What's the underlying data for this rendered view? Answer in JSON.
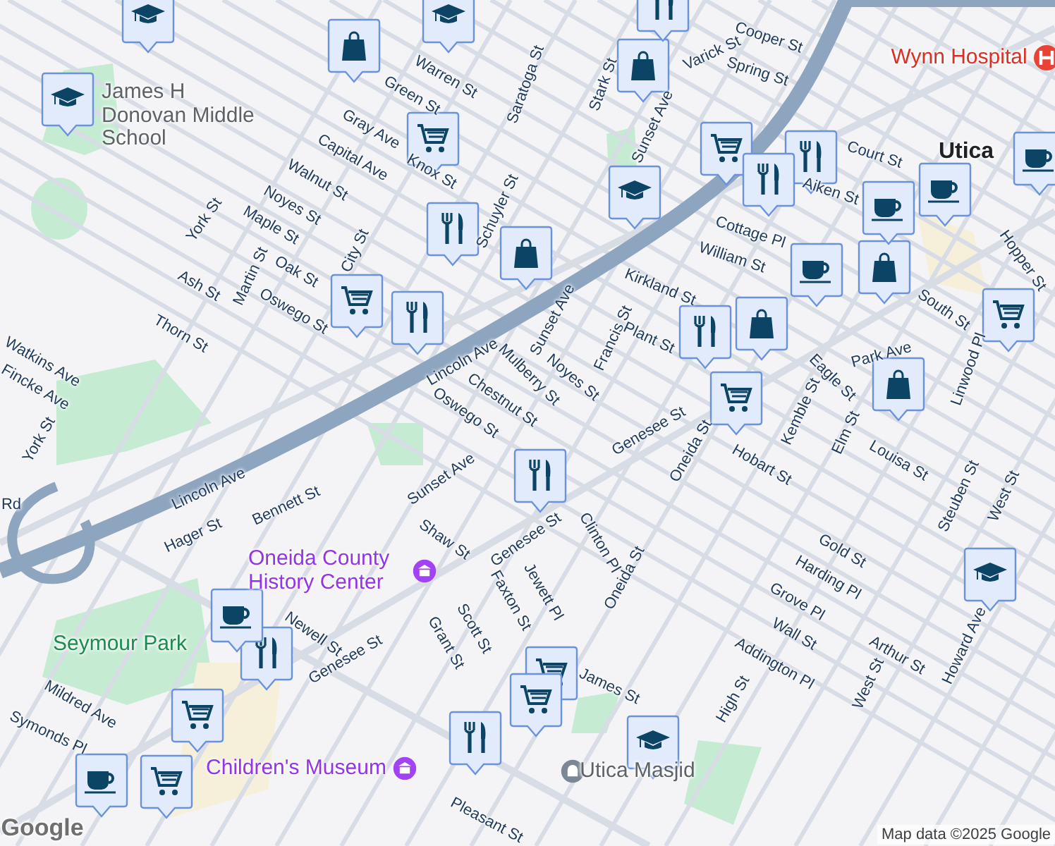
{
  "labels": [
    {
      "text": "Warren St",
      "kind": "street"
    },
    {
      "text": "Green St",
      "kind": "street"
    },
    {
      "text": "Saratoga St",
      "kind": "street"
    },
    {
      "text": "Gray Ave",
      "kind": "street"
    },
    {
      "text": "Capital Ave",
      "kind": "street"
    },
    {
      "text": "Walnut St",
      "kind": "street"
    },
    {
      "text": "Noyes St",
      "kind": "street"
    },
    {
      "text": "Maple St",
      "kind": "street"
    },
    {
      "text": "York St",
      "kind": "street"
    },
    {
      "text": "City St",
      "kind": "street"
    },
    {
      "text": "Martin St",
      "kind": "street"
    },
    {
      "text": "Oak St",
      "kind": "street"
    },
    {
      "text": "Ash St",
      "kind": "street"
    },
    {
      "text": "Oswego St",
      "kind": "street"
    },
    {
      "text": "Thorn St",
      "kind": "street"
    },
    {
      "text": "Knox St",
      "kind": "street"
    },
    {
      "text": "Schuyler St",
      "kind": "street"
    },
    {
      "text": "Watkins Ave",
      "kind": "street"
    },
    {
      "text": "Fincke Ave",
      "kind": "street"
    },
    {
      "text": "York St",
      "kind": "street"
    },
    {
      "text": "Lincoln Ave",
      "kind": "street"
    },
    {
      "text": "Mulberry St",
      "kind": "street"
    },
    {
      "text": "Chestnut St",
      "kind": "street"
    },
    {
      "text": "Oswego St",
      "kind": "street"
    },
    {
      "text": "Sunset Ave",
      "kind": "street"
    },
    {
      "text": "Noyes St",
      "kind": "street"
    },
    {
      "text": "Francis St",
      "kind": "street"
    },
    {
      "text": "Kirkland St",
      "kind": "street"
    },
    {
      "text": "Plant St",
      "kind": "street"
    },
    {
      "text": "Stark St",
      "kind": "street"
    },
    {
      "text": "Sunset Ave",
      "kind": "street"
    },
    {
      "text": "Varick St",
      "kind": "street"
    },
    {
      "text": "Cooper St",
      "kind": "street"
    },
    {
      "text": "Spring St",
      "kind": "street"
    },
    {
      "text": "Court St",
      "kind": "street"
    },
    {
      "text": "Aiken St",
      "kind": "street"
    },
    {
      "text": "Cottage Pl",
      "kind": "street"
    },
    {
      "text": "William St",
      "kind": "street"
    },
    {
      "text": "South St",
      "kind": "street"
    },
    {
      "text": "Hopper St",
      "kind": "street"
    },
    {
      "text": "Park Ave",
      "kind": "street"
    },
    {
      "text": "Eagle St",
      "kind": "street"
    },
    {
      "text": "Kemble St",
      "kind": "street"
    },
    {
      "text": "Elm St",
      "kind": "street"
    },
    {
      "text": "Linwood Pl",
      "kind": "street"
    },
    {
      "text": "Louisa St",
      "kind": "street"
    },
    {
      "text": "Hobart St",
      "kind": "street"
    },
    {
      "text": "Oneida St",
      "kind": "street"
    },
    {
      "text": "Genesee St",
      "kind": "street"
    },
    {
      "text": "Steuben St",
      "kind": "street"
    },
    {
      "text": "West St",
      "kind": "street"
    },
    {
      "text": "Gold St",
      "kind": "street"
    },
    {
      "text": "Harding Pl",
      "kind": "street"
    },
    {
      "text": "Grove Pl",
      "kind": "street"
    },
    {
      "text": "Wall St",
      "kind": "street"
    },
    {
      "text": "Addington Pl",
      "kind": "street"
    },
    {
      "text": "High St",
      "kind": "street"
    },
    {
      "text": "West St",
      "kind": "street"
    },
    {
      "text": "Arthur St",
      "kind": "street"
    },
    {
      "text": "Howard Ave",
      "kind": "street"
    },
    {
      "text": "Clinton Pl",
      "kind": "street"
    },
    {
      "text": "Oneida St",
      "kind": "street"
    },
    {
      "text": "Jewett Pl",
      "kind": "street"
    },
    {
      "text": "James St",
      "kind": "street"
    },
    {
      "text": "Lincoln Ave",
      "kind": "street"
    },
    {
      "text": "Bennett St",
      "kind": "street"
    },
    {
      "text": "Hager St",
      "kind": "street"
    },
    {
      "text": "Sunset Ave",
      "kind": "street"
    },
    {
      "text": "Shaw St",
      "kind": "street"
    },
    {
      "text": "Genesee St",
      "kind": "street"
    },
    {
      "text": "Genesee St",
      "kind": "street"
    },
    {
      "text": "Newell St",
      "kind": "street"
    },
    {
      "text": "Scott St",
      "kind": "street"
    },
    {
      "text": "Faxton St",
      "kind": "street"
    },
    {
      "text": "Grant St",
      "kind": "street"
    },
    {
      "text": "Mildred Ave",
      "kind": "street"
    },
    {
      "text": "Symonds Pl",
      "kind": "street"
    },
    {
      "text": "Pleasant St",
      "kind": "street"
    },
    {
      "text": "Rd",
      "kind": "street"
    },
    {
      "text": "James H Donovan Middle School",
      "kind": "place"
    },
    {
      "text": "Wynn Hospital",
      "kind": "hospital"
    },
    {
      "text": "Utica",
      "kind": "city"
    },
    {
      "text": "Oneida County History Center",
      "kind": "museum"
    },
    {
      "text": "Seymour Park",
      "kind": "park"
    },
    {
      "text": "Children's Museum",
      "kind": "museum"
    },
    {
      "text": "Utica Masjid",
      "kind": "mosque"
    },
    {
      "text": "Google",
      "kind": "logo"
    },
    {
      "text": "Map data ©2025 Google",
      "kind": "credit"
    }
  ],
  "markers": [
    {
      "kind": "school"
    },
    {
      "kind": "school"
    },
    {
      "kind": "school"
    },
    {
      "kind": "school"
    },
    {
      "kind": "school"
    },
    {
      "kind": "school"
    },
    {
      "kind": "shop"
    },
    {
      "kind": "shop"
    },
    {
      "kind": "shop"
    },
    {
      "kind": "shop"
    },
    {
      "kind": "shop"
    },
    {
      "kind": "shop"
    },
    {
      "kind": "cart"
    },
    {
      "kind": "cart"
    },
    {
      "kind": "cart"
    },
    {
      "kind": "cart"
    },
    {
      "kind": "cart"
    },
    {
      "kind": "cart"
    },
    {
      "kind": "cart"
    },
    {
      "kind": "cart"
    },
    {
      "kind": "cart"
    },
    {
      "kind": "food"
    },
    {
      "kind": "food"
    },
    {
      "kind": "food"
    },
    {
      "kind": "food"
    },
    {
      "kind": "food"
    },
    {
      "kind": "food"
    },
    {
      "kind": "food"
    },
    {
      "kind": "food"
    },
    {
      "kind": "food"
    },
    {
      "kind": "cafe"
    },
    {
      "kind": "cafe"
    },
    {
      "kind": "cafe"
    },
    {
      "kind": "cafe"
    },
    {
      "kind": "cafe"
    },
    {
      "kind": "cafe"
    }
  ]
}
